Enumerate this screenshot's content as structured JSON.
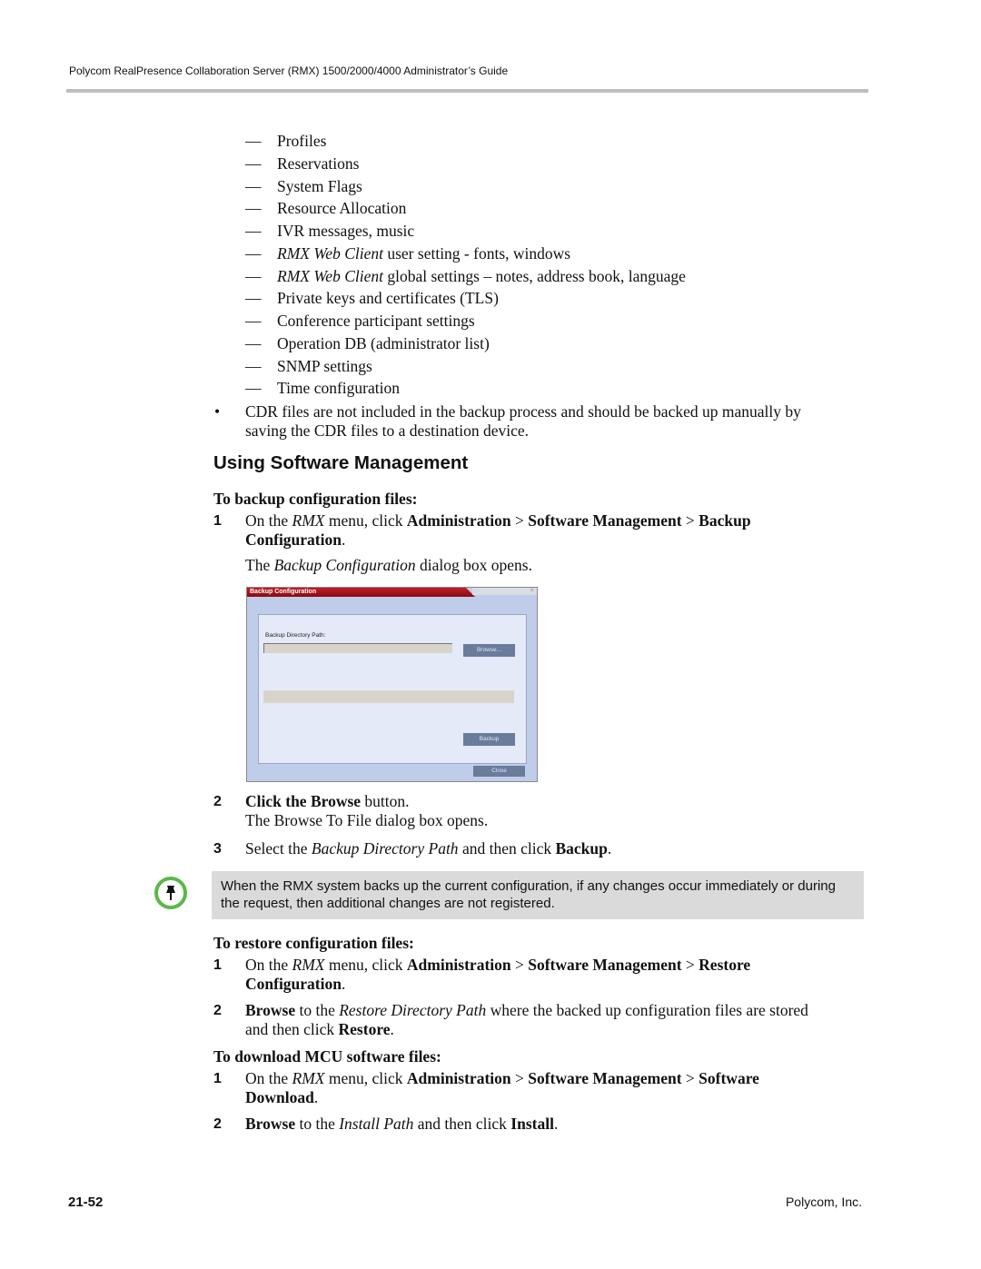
{
  "header": {
    "title": "Polycom RealPresence Collaboration Server (RMX) 1500/2000/4000 Administrator’s Guide"
  },
  "dash": "—",
  "bullet": "•",
  "sub_items": [
    [
      {
        "t": "Profiles"
      }
    ],
    [
      {
        "t": "Reservations"
      }
    ],
    [
      {
        "t": "System Flags"
      }
    ],
    [
      {
        "t": "Resource Allocation"
      }
    ],
    [
      {
        "t": "IVR messages, music"
      }
    ],
    [
      {
        "t": "RMX Web Client",
        "s": "i"
      },
      {
        "t": " user setting - fonts, windows"
      }
    ],
    [
      {
        "t": "RMX Web Client",
        "s": "i"
      },
      {
        "t": " global settings – notes, address book, language"
      }
    ],
    [
      {
        "t": "Private keys and certificates (TLS)"
      }
    ],
    [
      {
        "t": "Conference participant settings"
      }
    ],
    [
      {
        "t": "Operation DB (administrator list)"
      }
    ],
    [
      {
        "t": "SNMP settings"
      }
    ],
    [
      {
        "t": "Time configuration"
      }
    ]
  ],
  "cdr": [
    [
      {
        "t": "CDR files are not included in the backup process and should be backed up manually by"
      }
    ],
    [
      {
        "t": "saving the CDR files to a destination device."
      }
    ]
  ],
  "section_title": "Using Software Management",
  "backup": {
    "heading": "To backup configuration files:",
    "step1_num": "1",
    "step1": [
      [
        {
          "t": "On the "
        },
        {
          "t": "RMX",
          "s": "i"
        },
        {
          "t": " menu, click "
        },
        {
          "t": "Administration",
          "s": "b"
        },
        {
          "t": " > "
        },
        {
          "t": "Software Management",
          "s": "b"
        },
        {
          "t": " > "
        },
        {
          "t": "Backup",
          "s": "b"
        }
      ],
      [
        {
          "t": "Configuration",
          "s": "b"
        },
        {
          "t": "."
        }
      ],
      [
        {
          "t": "The "
        },
        {
          "t": "Backup Configuration",
          "s": "i"
        },
        {
          "t": " dialog box opens."
        }
      ]
    ],
    "dialog": {
      "title": "Backup Configuration",
      "close_x": "×",
      "path_label": "Backup Directory Path:",
      "browse": "Browse...",
      "backup": "Backup",
      "close": "Close"
    },
    "step2_num": "2",
    "step2": [
      [
        {
          "t": "Click the Browse",
          "s": "b"
        },
        {
          "t": " button."
        }
      ],
      [
        {
          "t": "The Browse To File dialog box opens."
        }
      ]
    ],
    "step3_num": "3",
    "step3": [
      [
        {
          "t": "Select the "
        },
        {
          "t": "Backup Directory Path",
          "s": "i"
        },
        {
          "t": " and then click "
        },
        {
          "t": "Backup",
          "s": "b"
        },
        {
          "t": "."
        }
      ]
    ]
  },
  "note": {
    "icon": "pushpin-icon",
    "text": "When the RMX system backs up the current configuration, if any changes occur immediately or during the request, then additional changes are not registered."
  },
  "restore": {
    "heading": "To restore configuration files:",
    "step1_num": "1",
    "step1": [
      [
        {
          "t": "On the "
        },
        {
          "t": "RMX",
          "s": "i"
        },
        {
          "t": " menu, click "
        },
        {
          "t": "Administration",
          "s": "b"
        },
        {
          "t": " > "
        },
        {
          "t": "Software Management",
          "s": "b"
        },
        {
          "t": " > "
        },
        {
          "t": "Restore",
          "s": "b"
        }
      ],
      [
        {
          "t": "Configuration",
          "s": "b"
        },
        {
          "t": "."
        }
      ]
    ],
    "step2_num": "2",
    "step2": [
      [
        {
          "t": "Browse",
          "s": "b"
        },
        {
          "t": " to the "
        },
        {
          "t": "Restore Directory Path",
          "s": "i"
        },
        {
          "t": " where the backed up configuration files are stored"
        }
      ],
      [
        {
          "t": "and then click "
        },
        {
          "t": "Restore",
          "s": "b"
        },
        {
          "t": "."
        }
      ]
    ]
  },
  "download": {
    "heading": "To download MCU software files:",
    "step1_num": "1",
    "step1": [
      [
        {
          "t": "On the "
        },
        {
          "t": "RMX",
          "s": "i"
        },
        {
          "t": " menu, click "
        },
        {
          "t": "Administration",
          "s": "b"
        },
        {
          "t": " > "
        },
        {
          "t": "Software Management",
          "s": "b"
        },
        {
          "t": " > "
        },
        {
          "t": "Software",
          "s": "b"
        }
      ],
      [
        {
          "t": "Download",
          "s": "b"
        },
        {
          "t": "."
        }
      ]
    ],
    "step2_num": "2",
    "step2": [
      [
        {
          "t": "Browse",
          "s": "b"
        },
        {
          "t": " to the "
        },
        {
          "t": "Install Path",
          "s": "i"
        },
        {
          "t": " and then click "
        },
        {
          "t": "Install",
          "s": "b"
        },
        {
          "t": "."
        }
      ]
    ]
  },
  "footer": {
    "page": "21-52",
    "company": "Polycom, Inc."
  },
  "colors": {
    "note_bg": "#dadada",
    "pin_ring": "#5cb848",
    "dialog_title": "#b01820"
  }
}
